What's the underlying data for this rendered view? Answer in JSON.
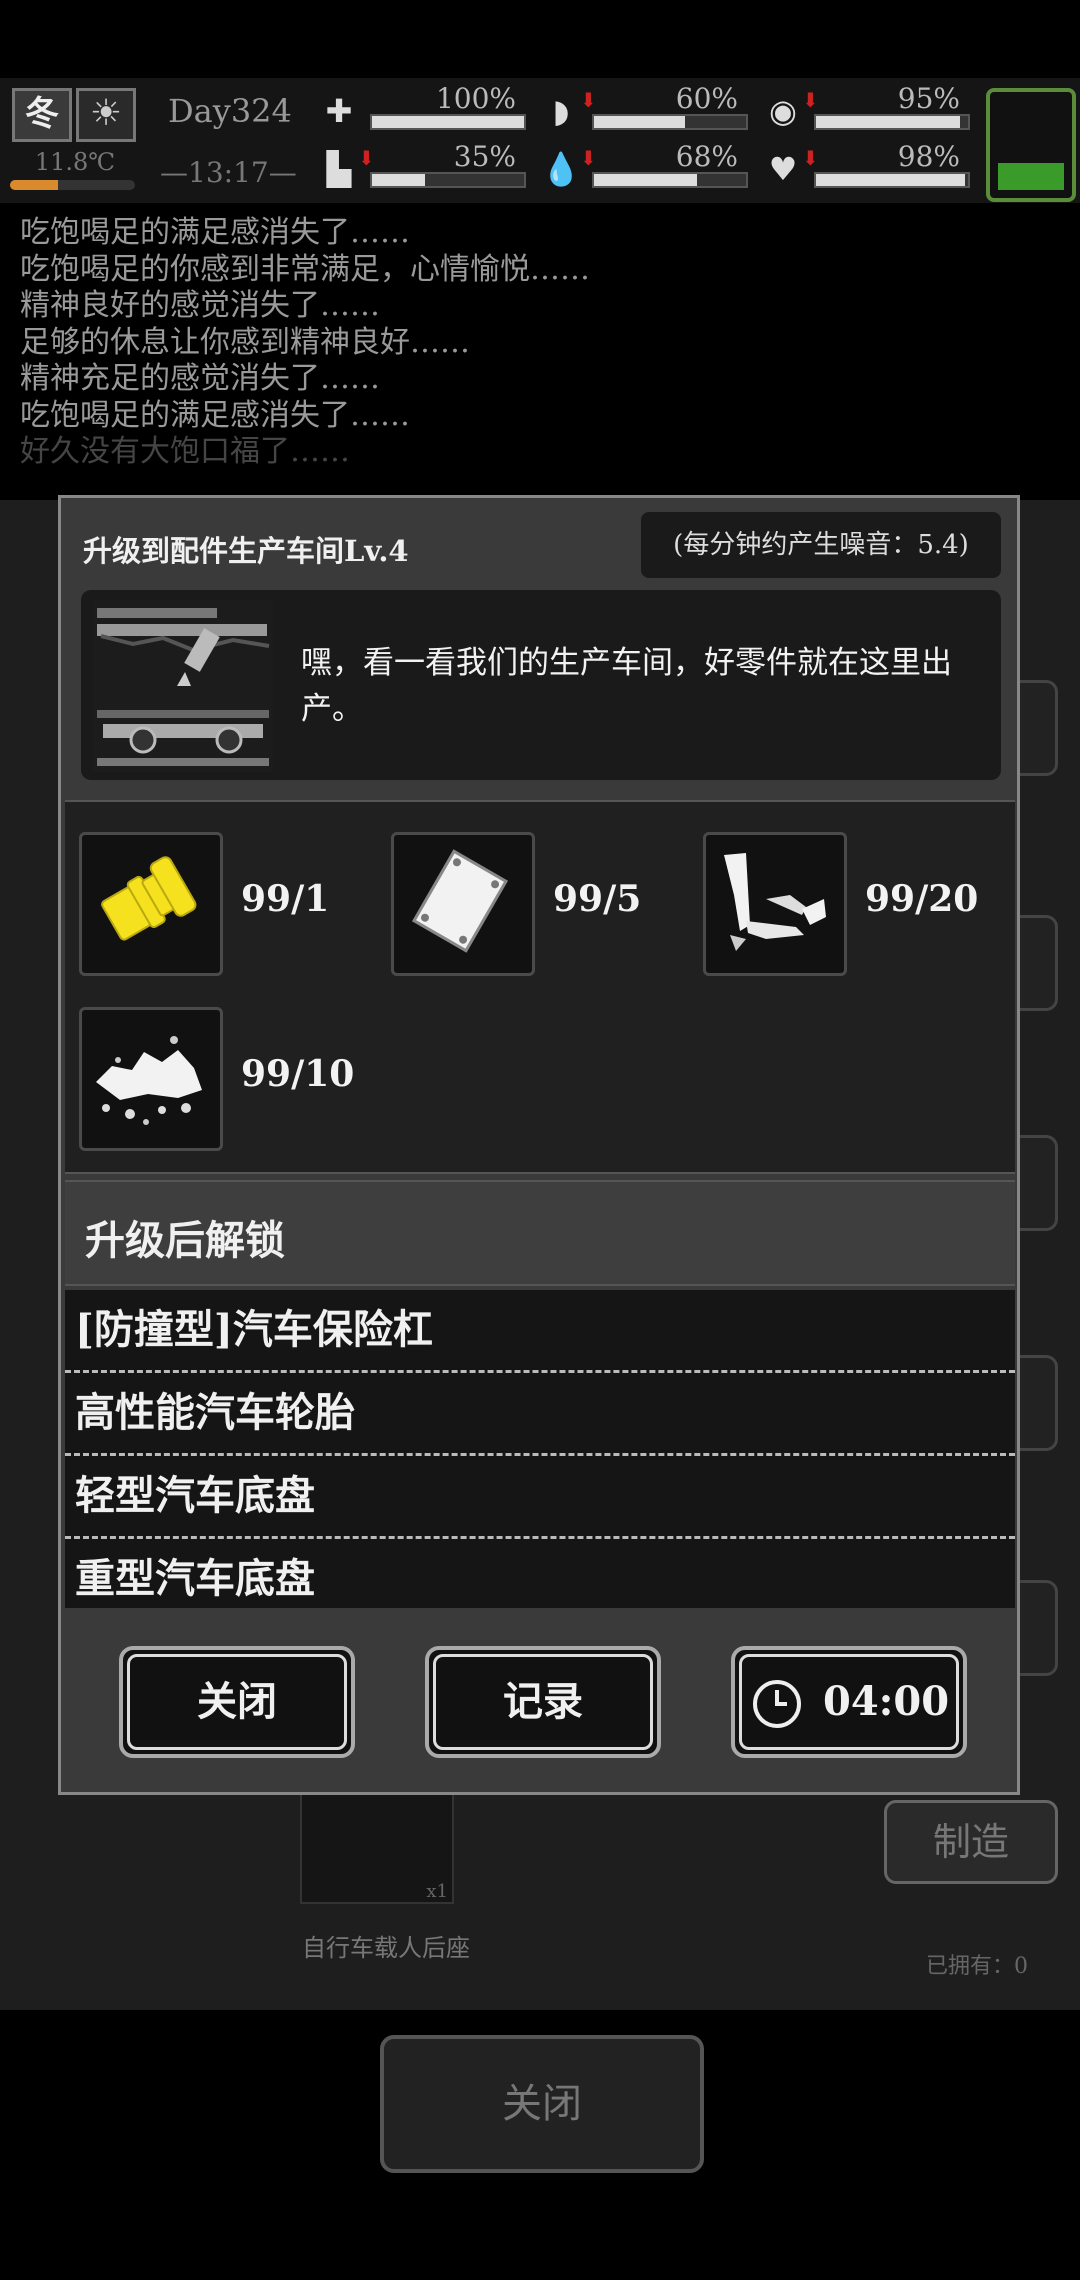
{
  "status": {
    "season": "冬",
    "temperature": "11.8℃",
    "temperature_level": 0.38,
    "day": "Day324",
    "time": "—13:17—",
    "stats": [
      {
        "icon": "health-icon",
        "value": "100%",
        "level": 1.0,
        "falling": false
      },
      {
        "icon": "stomach-icon",
        "value": "60%",
        "level": 0.6,
        "falling": true
      },
      {
        "icon": "energy-icon",
        "value": "95%",
        "level": 0.95,
        "falling": true
      },
      {
        "icon": "foot-icon",
        "value": "35%",
        "level": 0.35,
        "falling": true
      },
      {
        "icon": "water-drop-icon",
        "value": "68%",
        "level": 0.68,
        "falling": true
      },
      {
        "icon": "heart-icon",
        "value": "98%",
        "level": 0.98,
        "falling": true
      }
    ],
    "battery_level": 0.3,
    "colors": {
      "temperature": "#d98a2c",
      "battery": "#3a9a2a",
      "falling": "#cc2222"
    }
  },
  "log": [
    "吃饱喝足的满足感消失了……",
    "吃饱喝足的你感到非常满足，心情愉悦……",
    "精神良好的感觉消失了……",
    "足够的休息让你感到精神良好……",
    "精神充足的感觉消失了……",
    "吃饱喝足的满足感消失了……",
    "好久没有大饱口福了……"
  ],
  "background": {
    "craft_label": "制造",
    "item_count": "x1",
    "recipe_name": "自行车载人后座",
    "owned": "已拥有：0",
    "close_label": "关闭"
  },
  "modal": {
    "title": "升级到配件生产车间Lv.4",
    "noise": "(每分钟约产生噪音：5.4)",
    "description": "嘿，看一看我们的生产车间，好零件就在这里出产。",
    "materials": [
      {
        "icon": "bolt-icon",
        "count": "99/1"
      },
      {
        "icon": "metal-sheet-icon",
        "count": "99/5"
      },
      {
        "icon": "scrap-parts-icon",
        "count": "99/20"
      },
      {
        "icon": "gravel-icon",
        "count": "99/10"
      }
    ],
    "unlock_header": "升级后解锁",
    "unlocks": [
      "[防撞型]汽车保险杠",
      "高性能汽车轮胎",
      "轻型汽车底盘",
      "重型汽车底盘"
    ],
    "buttons": {
      "close": "关闭",
      "record": "记录",
      "timer": "04:00"
    }
  }
}
